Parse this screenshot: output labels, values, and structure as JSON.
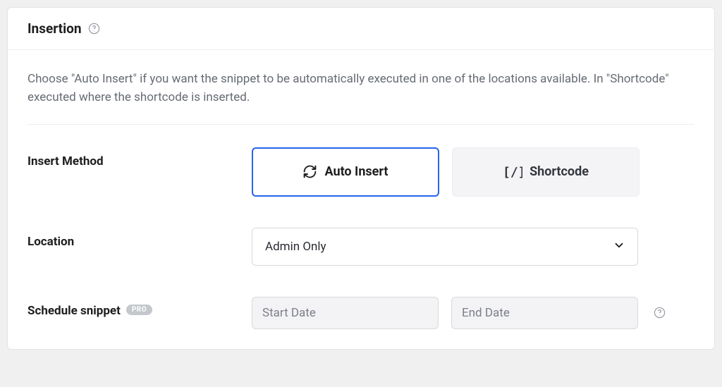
{
  "panel": {
    "title": "Insertion",
    "description": "Choose \"Auto Insert\" if you want the snippet to be automatically executed in one of the locations available. In \"Shortcode\" executed where the shortcode is inserted."
  },
  "insert_method": {
    "label": "Insert Method",
    "auto_insert_label": "Auto Insert",
    "shortcode_label": "Shortcode"
  },
  "location": {
    "label": "Location",
    "value": "Admin Only"
  },
  "schedule": {
    "label": "Schedule snippet",
    "pro_badge": "PRO",
    "start_placeholder": "Start Date",
    "end_placeholder": "End Date"
  }
}
